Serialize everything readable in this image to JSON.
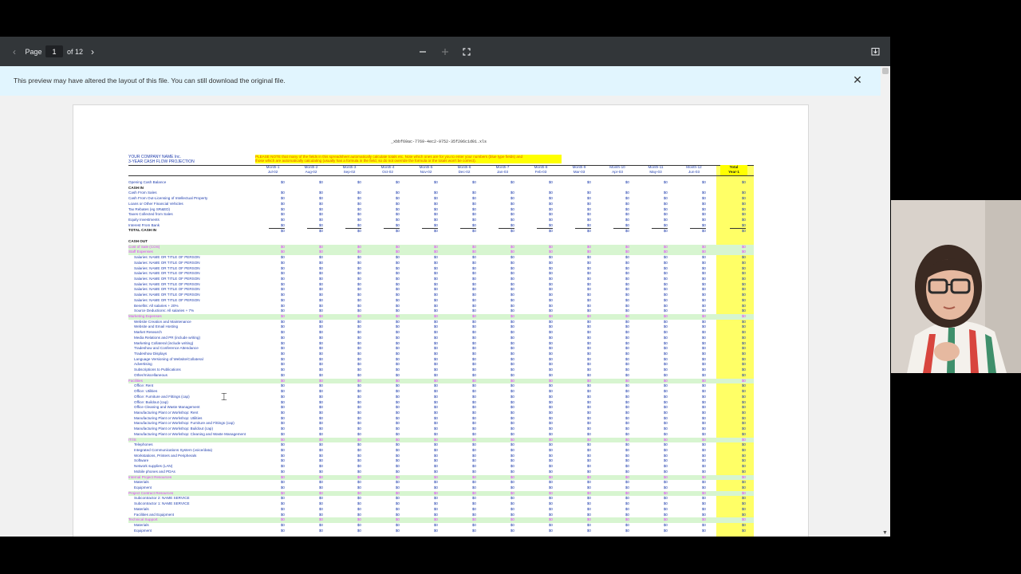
{
  "toolbar": {
    "page_label": "Page",
    "page_number": "1",
    "page_total": "of 12"
  },
  "banner": {
    "message": "This preview may have altered the layout of this file. You can still download the original file."
  },
  "sheet": {
    "title": "_xbbf69ac-7769-4ec2-9752-35f206c1d01.xls",
    "company_line1": "YOUR COMPANY NAME Inc.",
    "company_line2": "3-YEAR CASH FLOW PROJECTION",
    "note_line1": "PLEASE NOTE that many of the fields in this spreadsheet automatically calculate totals etc. Note which ones are for you to enter your numbers (blue type fields) and",
    "note_line2": "those which are automatically calculating (usually has a formula in the field, so do not override the formula or the totals won't be correct).",
    "months": [
      {
        "m": "Month-1",
        "d": "Jul-02"
      },
      {
        "m": "Month-2",
        "d": "Aug-02"
      },
      {
        "m": "Month-3",
        "d": "Sep-02"
      },
      {
        "m": "Month-4",
        "d": "Oct-02"
      },
      {
        "m": "Month-5",
        "d": "Nov-02"
      },
      {
        "m": "Month-6",
        "d": "Dec-02"
      },
      {
        "m": "Month-7",
        "d": "Jan-03"
      },
      {
        "m": "Month-8",
        "d": "Feb-03"
      },
      {
        "m": "Month-9",
        "d": "Mar-03"
      },
      {
        "m": "Month-10",
        "d": "Apr-03"
      },
      {
        "m": "Month-11",
        "d": "May-03"
      },
      {
        "m": "Month-12",
        "d": "Jun-03"
      },
      {
        "m": "Total",
        "d": "Year-1"
      }
    ],
    "cell_value": "$0",
    "rows": [
      {
        "t": "Opening Cash Balance",
        "k": "plain",
        "v": true
      },
      {
        "t": "CASH IN",
        "k": "bold",
        "v": false
      },
      {
        "t": "Cash From Sales",
        "k": "plain",
        "v": true
      },
      {
        "t": "Cash From Out-Licensing of Intellectual Property",
        "k": "plain",
        "v": true
      },
      {
        "t": "Loans or Other Financial Vehicles",
        "k": "plain",
        "v": true
      },
      {
        "t": "Tax Rebates (eg SR&ED)",
        "k": "plain",
        "v": true
      },
      {
        "t": "Taxes Collected from Sales",
        "k": "plain",
        "v": true
      },
      {
        "t": "Equity Investments",
        "k": "plain",
        "v": true
      },
      {
        "t": "Interest From Bank",
        "k": "plain",
        "v": true
      },
      {
        "t": "TOTAL CASH IN",
        "k": "total",
        "v": true
      },
      {
        "t": "",
        "k": "blank",
        "v": false
      },
      {
        "t": "CASH OUT",
        "k": "bold",
        "v": false
      },
      {
        "t": "Cost of Sale (COS)",
        "k": "cat",
        "v": true
      },
      {
        "t": "Staff Expenses",
        "k": "cat",
        "v": true
      },
      {
        "t": "Salaries: NAME OR TITLE OF PERSON",
        "k": "indent",
        "v": true
      },
      {
        "t": "Salaries: NAME OR TITLE OF PERSON",
        "k": "indent",
        "v": true
      },
      {
        "t": "Salaries: NAME OR TITLE OF PERSON",
        "k": "indent",
        "v": true
      },
      {
        "t": "Salaries: NAME OR TITLE OF PERSON",
        "k": "indent",
        "v": true
      },
      {
        "t": "Salaries: NAME OR TITLE OF PERSON",
        "k": "indent",
        "v": true
      },
      {
        "t": "Salaries: NAME OR TITLE OF PERSON",
        "k": "indent",
        "v": true
      },
      {
        "t": "Salaries: NAME OR TITLE OF PERSON",
        "k": "indent",
        "v": true
      },
      {
        "t": "Salaries: NAME OR TITLE OF PERSON",
        "k": "indent",
        "v": true
      },
      {
        "t": "Salaries: NAME OR TITLE OF PERSON",
        "k": "indent",
        "v": true
      },
      {
        "t": "Benefits: All salaries + 20%",
        "k": "indent",
        "v": true
      },
      {
        "t": "Source Deductions: All salaries + 7%",
        "k": "indent",
        "v": true
      },
      {
        "t": "Marketing Expenses",
        "k": "cat",
        "v": true
      },
      {
        "t": "Website Creation and Maintenance",
        "k": "indent",
        "v": true
      },
      {
        "t": "Website and Email Hosting",
        "k": "indent",
        "v": true
      },
      {
        "t": "Market Research",
        "k": "indent",
        "v": true
      },
      {
        "t": "Media Relations and PR (include writing)",
        "k": "indent",
        "v": true
      },
      {
        "t": "Marketing Collateral (include writing)",
        "k": "indent",
        "v": true
      },
      {
        "t": "Tradeshow and Conference Attendance",
        "k": "indent",
        "v": true
      },
      {
        "t": "Tradeshow Displays",
        "k": "indent",
        "v": true
      },
      {
        "t": "Language Versioning of Website/Collateral",
        "k": "indent",
        "v": true
      },
      {
        "t": "Advertising",
        "k": "indent",
        "v": true
      },
      {
        "t": "Subscriptions to Publications",
        "k": "indent",
        "v": true
      },
      {
        "t": "Other/miscellaneous",
        "k": "indent",
        "v": true
      },
      {
        "t": "Facilities",
        "k": "cat",
        "v": true
      },
      {
        "t": "Office: Rent",
        "k": "indent",
        "v": true
      },
      {
        "t": "Office: Utilities",
        "k": "indent",
        "v": true
      },
      {
        "t": "Office: Furniture and Fittings (cap)",
        "k": "indent",
        "v": true
      },
      {
        "t": "Office: Buildout (cap)",
        "k": "indent",
        "v": true
      },
      {
        "t": "Office Cleaning and Waste Management",
        "k": "indent",
        "v": true
      },
      {
        "t": "Manufacturing Plant or Workshop: Rent",
        "k": "indent",
        "v": true
      },
      {
        "t": "Manufacturing Plant or Workshop: Utilities",
        "k": "indent",
        "v": true
      },
      {
        "t": "Manufacturing Plant or Workshop: Furniture and Fittings (cap)",
        "k": "indent",
        "v": true
      },
      {
        "t": "Manufacturing Plant or Workshop: Buildout (cap)",
        "k": "indent",
        "v": true
      },
      {
        "t": "Manufacturing Plant or Workshop: Cleaning and Waste Management",
        "k": "indent",
        "v": true
      },
      {
        "t": "IT/IS",
        "k": "cat",
        "v": true
      },
      {
        "t": "Telephones",
        "k": "indent",
        "v": true
      },
      {
        "t": "Integrated Communications System (voice/data)",
        "k": "indent",
        "v": true
      },
      {
        "t": "Workstations, Printers and Peripherals",
        "k": "indent",
        "v": true
      },
      {
        "t": "Software",
        "k": "indent",
        "v": true
      },
      {
        "t": "Network supplies (LAN)",
        "k": "indent",
        "v": true
      },
      {
        "t": "Mobile phones and PDAs",
        "k": "indent",
        "v": true
      },
      {
        "t": "Internal Project Resources",
        "k": "cat",
        "v": true
      },
      {
        "t": "Materials",
        "k": "indent",
        "v": true
      },
      {
        "t": "Equipment",
        "k": "indent",
        "v": true
      },
      {
        "t": "Project Contract Resources",
        "k": "cat",
        "v": true
      },
      {
        "t": "Subcontractor 2: NAME SERVICE",
        "k": "indent",
        "v": true
      },
      {
        "t": "Subcontractor 1: NAME SERVICE",
        "k": "indent",
        "v": true
      },
      {
        "t": "Materials",
        "k": "indent",
        "v": true
      },
      {
        "t": "Facilities and Equipment",
        "k": "indent",
        "v": true
      },
      {
        "t": "Technical Support",
        "k": "cat",
        "v": true
      },
      {
        "t": "Materials",
        "k": "indent",
        "v": true
      },
      {
        "t": "Equipment",
        "k": "indent",
        "v": true
      }
    ]
  },
  "webcam": {
    "subject": "presenter-webcam-feed",
    "colors": {
      "background": "#d9d2cb",
      "hair": "#3b2a22",
      "skin": "#e6b9a0",
      "glasses": "#2b2b2b",
      "shirt_stripe_red": "#d8453e",
      "shirt_stripe_green": "#3f8f6b",
      "shirt_white": "#f4f1ec"
    }
  },
  "icons": {
    "prev": "chevron-left-icon",
    "next": "chevron-right-icon",
    "zoom_out": "minus-icon",
    "zoom_in": "plus-icon",
    "fit": "fit-page-icon",
    "download": "download-icon",
    "close": "close-icon",
    "cursor": "text-cursor-icon"
  }
}
